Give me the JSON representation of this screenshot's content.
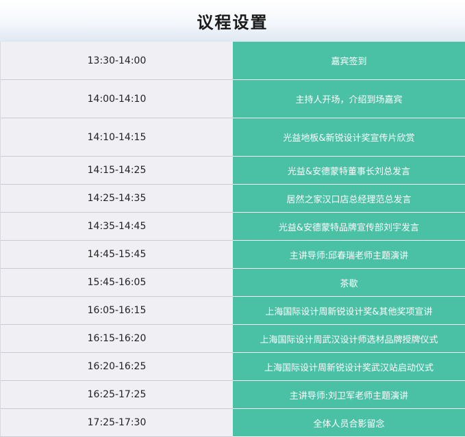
{
  "header": {
    "title": "议程设置"
  },
  "agenda": [
    {
      "time": "13:30-14:00",
      "item": "嘉宾签到"
    },
    {
      "time": "14:00-14:10",
      "item": "主持人开场，介绍到场嘉宾"
    },
    {
      "time": "14:10-14:15",
      "item": "光益地板&新锐设计奖宣传片欣赏"
    },
    {
      "time": "14:15-14:25",
      "item": "光益&安德蒙特董事长刘总发言"
    },
    {
      "time": "14:25-14:35",
      "item": "居然之家汉口店总经理范总发言"
    },
    {
      "time": "14:35-14:45",
      "item": "光益&安德蒙特品牌宣传部刘宇发言"
    },
    {
      "time": "14:45-15:45",
      "item": "主讲导师:邱春瑞老师主题演讲"
    },
    {
      "time": "15:45-16:05",
      "item": "茶歇"
    },
    {
      "time": "16:05-16:15",
      "item": "上海国际设计周新锐设计奖&其他奖项宣讲"
    },
    {
      "time": "16:15-16:20",
      "item": "上海国际设计周武汉设计师选材品牌授牌仪式"
    },
    {
      "time": "16:20-16:25",
      "item": "上海国际设计周新锐设计奖武汉站启动仪式"
    },
    {
      "time": "16:25-17:25",
      "item": "主讲导师:刘卫军老师主题演讲"
    },
    {
      "time": "17:25-17:30",
      "item": "全体人员合影留念"
    }
  ]
}
